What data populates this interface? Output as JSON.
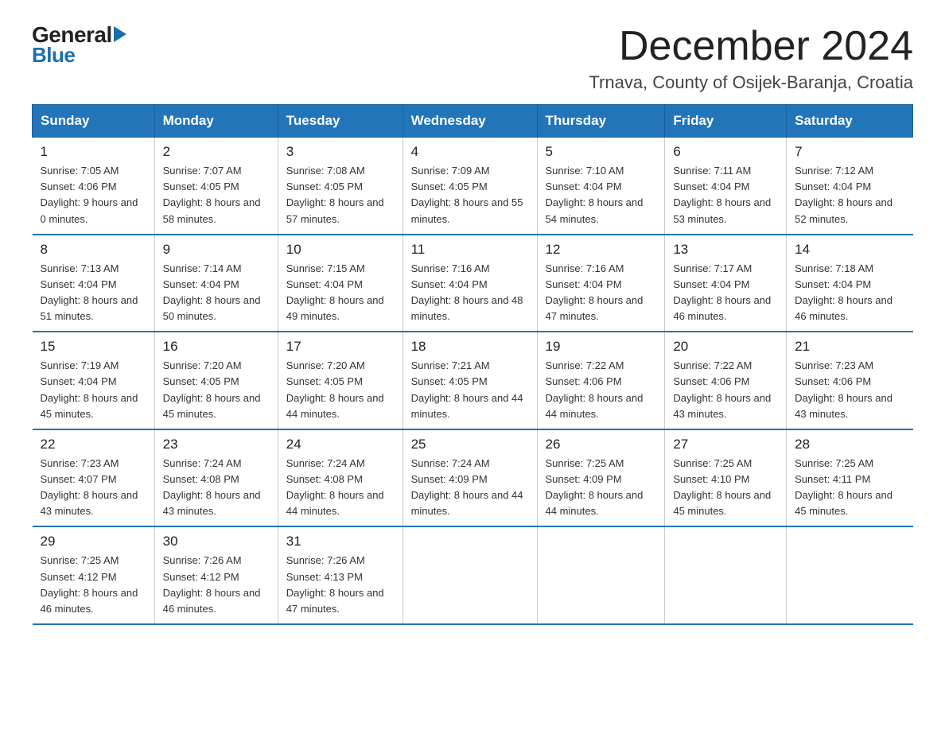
{
  "header": {
    "logo_general": "General",
    "logo_blue": "Blue",
    "month_title": "December 2024",
    "location": "Trnava, County of Osijek-Baranja, Croatia"
  },
  "days_of_week": [
    "Sunday",
    "Monday",
    "Tuesday",
    "Wednesday",
    "Thursday",
    "Friday",
    "Saturday"
  ],
  "weeks": [
    [
      {
        "day": "1",
        "sunrise": "7:05 AM",
        "sunset": "4:06 PM",
        "daylight": "9 hours and 0 minutes."
      },
      {
        "day": "2",
        "sunrise": "7:07 AM",
        "sunset": "4:05 PM",
        "daylight": "8 hours and 58 minutes."
      },
      {
        "day": "3",
        "sunrise": "7:08 AM",
        "sunset": "4:05 PM",
        "daylight": "8 hours and 57 minutes."
      },
      {
        "day": "4",
        "sunrise": "7:09 AM",
        "sunset": "4:05 PM",
        "daylight": "8 hours and 55 minutes."
      },
      {
        "day": "5",
        "sunrise": "7:10 AM",
        "sunset": "4:04 PM",
        "daylight": "8 hours and 54 minutes."
      },
      {
        "day": "6",
        "sunrise": "7:11 AM",
        "sunset": "4:04 PM",
        "daylight": "8 hours and 53 minutes."
      },
      {
        "day": "7",
        "sunrise": "7:12 AM",
        "sunset": "4:04 PM",
        "daylight": "8 hours and 52 minutes."
      }
    ],
    [
      {
        "day": "8",
        "sunrise": "7:13 AM",
        "sunset": "4:04 PM",
        "daylight": "8 hours and 51 minutes."
      },
      {
        "day": "9",
        "sunrise": "7:14 AM",
        "sunset": "4:04 PM",
        "daylight": "8 hours and 50 minutes."
      },
      {
        "day": "10",
        "sunrise": "7:15 AM",
        "sunset": "4:04 PM",
        "daylight": "8 hours and 49 minutes."
      },
      {
        "day": "11",
        "sunrise": "7:16 AM",
        "sunset": "4:04 PM",
        "daylight": "8 hours and 48 minutes."
      },
      {
        "day": "12",
        "sunrise": "7:16 AM",
        "sunset": "4:04 PM",
        "daylight": "8 hours and 47 minutes."
      },
      {
        "day": "13",
        "sunrise": "7:17 AM",
        "sunset": "4:04 PM",
        "daylight": "8 hours and 46 minutes."
      },
      {
        "day": "14",
        "sunrise": "7:18 AM",
        "sunset": "4:04 PM",
        "daylight": "8 hours and 46 minutes."
      }
    ],
    [
      {
        "day": "15",
        "sunrise": "7:19 AM",
        "sunset": "4:04 PM",
        "daylight": "8 hours and 45 minutes."
      },
      {
        "day": "16",
        "sunrise": "7:20 AM",
        "sunset": "4:05 PM",
        "daylight": "8 hours and 45 minutes."
      },
      {
        "day": "17",
        "sunrise": "7:20 AM",
        "sunset": "4:05 PM",
        "daylight": "8 hours and 44 minutes."
      },
      {
        "day": "18",
        "sunrise": "7:21 AM",
        "sunset": "4:05 PM",
        "daylight": "8 hours and 44 minutes."
      },
      {
        "day": "19",
        "sunrise": "7:22 AM",
        "sunset": "4:06 PM",
        "daylight": "8 hours and 44 minutes."
      },
      {
        "day": "20",
        "sunrise": "7:22 AM",
        "sunset": "4:06 PM",
        "daylight": "8 hours and 43 minutes."
      },
      {
        "day": "21",
        "sunrise": "7:23 AM",
        "sunset": "4:06 PM",
        "daylight": "8 hours and 43 minutes."
      }
    ],
    [
      {
        "day": "22",
        "sunrise": "7:23 AM",
        "sunset": "4:07 PM",
        "daylight": "8 hours and 43 minutes."
      },
      {
        "day": "23",
        "sunrise": "7:24 AM",
        "sunset": "4:08 PM",
        "daylight": "8 hours and 43 minutes."
      },
      {
        "day": "24",
        "sunrise": "7:24 AM",
        "sunset": "4:08 PM",
        "daylight": "8 hours and 44 minutes."
      },
      {
        "day": "25",
        "sunrise": "7:24 AM",
        "sunset": "4:09 PM",
        "daylight": "8 hours and 44 minutes."
      },
      {
        "day": "26",
        "sunrise": "7:25 AM",
        "sunset": "4:09 PM",
        "daylight": "8 hours and 44 minutes."
      },
      {
        "day": "27",
        "sunrise": "7:25 AM",
        "sunset": "4:10 PM",
        "daylight": "8 hours and 45 minutes."
      },
      {
        "day": "28",
        "sunrise": "7:25 AM",
        "sunset": "4:11 PM",
        "daylight": "8 hours and 45 minutes."
      }
    ],
    [
      {
        "day": "29",
        "sunrise": "7:25 AM",
        "sunset": "4:12 PM",
        "daylight": "8 hours and 46 minutes."
      },
      {
        "day": "30",
        "sunrise": "7:26 AM",
        "sunset": "4:12 PM",
        "daylight": "8 hours and 46 minutes."
      },
      {
        "day": "31",
        "sunrise": "7:26 AM",
        "sunset": "4:13 PM",
        "daylight": "8 hours and 47 minutes."
      },
      null,
      null,
      null,
      null
    ]
  ]
}
